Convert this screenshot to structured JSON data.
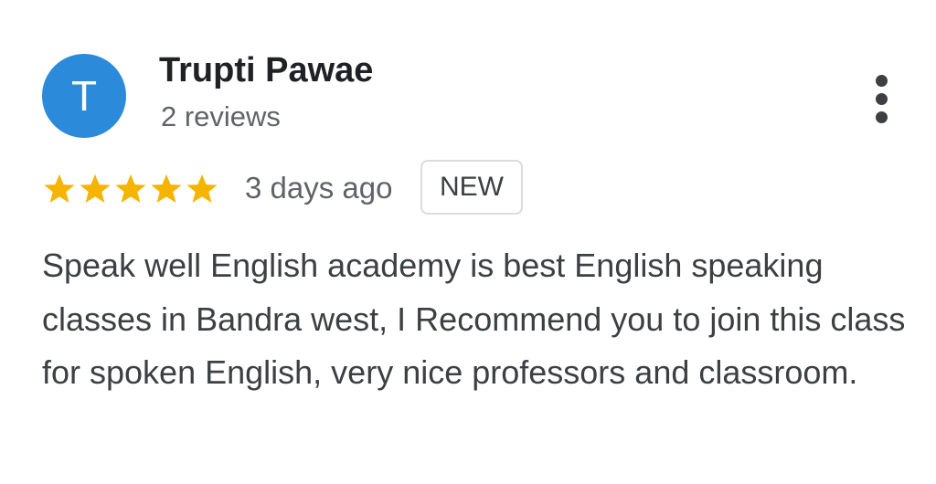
{
  "review": {
    "avatar_initial": "T",
    "reviewer_name": "Trupti Pawae",
    "review_count": "2 reviews",
    "rating": 5,
    "max_rating": 5,
    "date": "3 days ago",
    "badge": "NEW",
    "text": "Speak well English academy is best English speaking classes in Bandra west, I Recommend you to join this class for spoken English, very nice professors and classroom."
  },
  "icons": {
    "menu": "more-vert-icon",
    "star": "star-icon"
  },
  "colors": {
    "avatar_background": "#2b8ad9",
    "star": "#f4b400",
    "name": "#202124",
    "secondary_text": "#5f6368",
    "body_text": "#3c4043",
    "badge_border": "#dadce0"
  }
}
